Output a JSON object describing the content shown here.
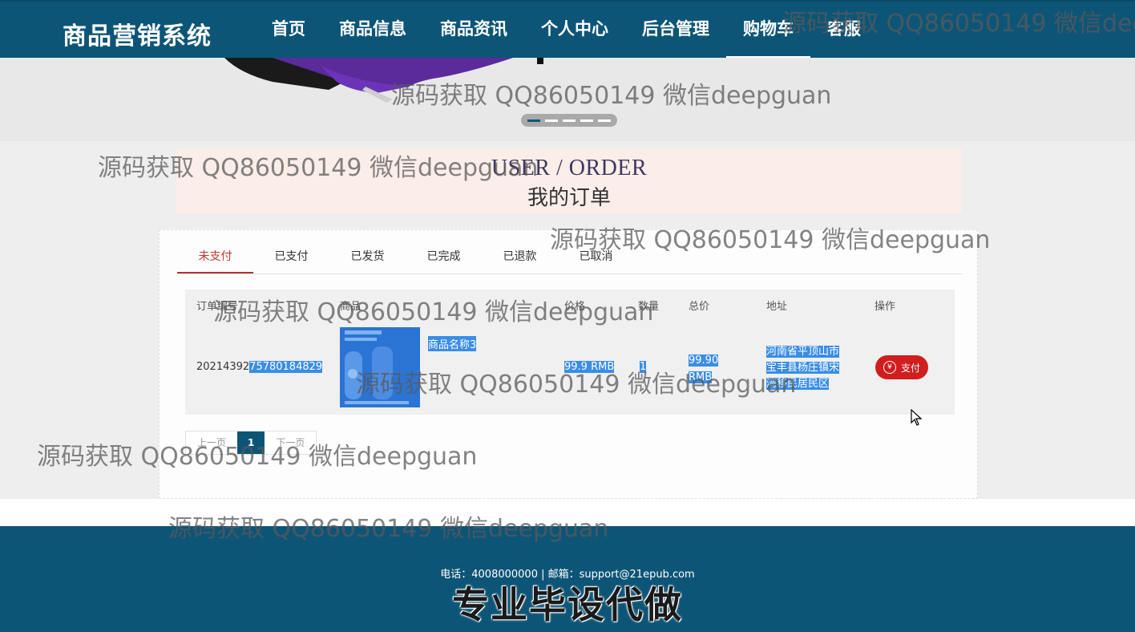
{
  "header": {
    "logo": "商品营销系统",
    "nav": [
      "首页",
      "商品信息",
      "商品资讯",
      "个人中心",
      "后台管理",
      "购物车",
      "客服"
    ],
    "active_nav": "购物车"
  },
  "banner": {
    "slides": 5,
    "active_slide": 0
  },
  "section": {
    "title_en": "USER / ORDER",
    "title_cn": "我的订单"
  },
  "tabs": [
    "未支付",
    "已支付",
    "已发货",
    "已完成",
    "已退款",
    "已取消"
  ],
  "active_tab": "未支付",
  "table": {
    "headers": [
      "订单编号",
      "商品",
      "价格",
      "数量",
      "总价",
      "地址",
      "操作"
    ],
    "rows": [
      {
        "order_id_prefix": "20214392",
        "order_id_suffix": "75780184829",
        "product_name": "商品名称3",
        "price": "99.9 RMB",
        "quantity": "1",
        "total_line1": "99.90",
        "total_line2": "RMB",
        "address_line1": "河南省平顶山市",
        "address_line2": "宝丰县杨庄镇宋",
        "address_line3": "湾移民居民区",
        "action": "支付",
        "action_icon": "yen-icon"
      }
    ]
  },
  "pager": {
    "prev": "上一页",
    "current": "1",
    "next": "下一页"
  },
  "footer": {
    "contact": "电话：4008000000 | 邮箱：support@21epub.com",
    "promo": "专业毕设代做"
  },
  "watermark": "源码获取 QQ86050149 微信deepguan",
  "colors": {
    "primary": "#0d5577",
    "accent": "#d01e1e",
    "selection": "#3a8ee6"
  }
}
